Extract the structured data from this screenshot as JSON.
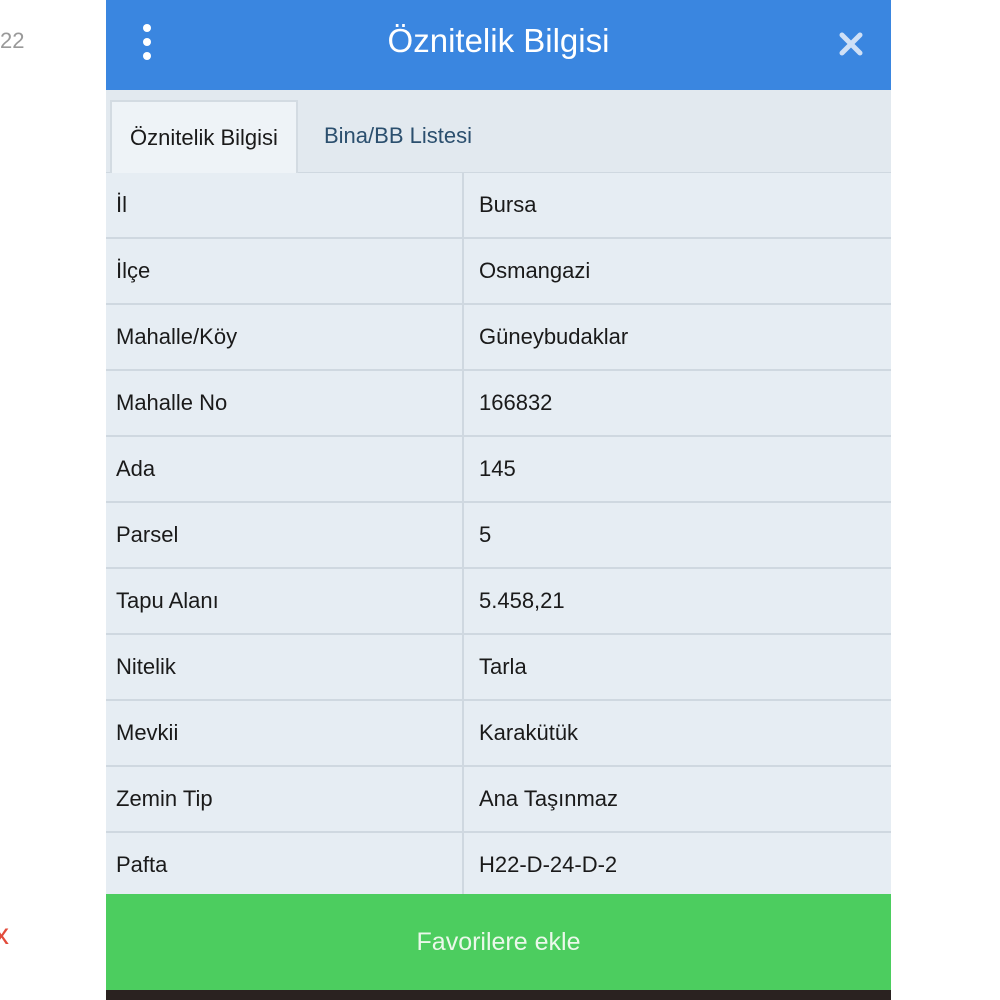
{
  "background": {
    "top_fragment": "22",
    "x_fragment": "x"
  },
  "header": {
    "title": "Öznitelik Bilgisi",
    "menu_icon": "vertical-dots-icon",
    "close_icon": "close-icon",
    "color": "#3a86e0"
  },
  "tabs": [
    {
      "label": "Öznitelik Bilgisi",
      "active": true
    },
    {
      "label": "Bina/BB Listesi",
      "active": false
    }
  ],
  "rows": [
    {
      "key": "İl",
      "value": "Bursa"
    },
    {
      "key": "İlçe",
      "value": "Osmangazi"
    },
    {
      "key": "Mahalle/Köy",
      "value": "Güneybudaklar"
    },
    {
      "key": "Mahalle No",
      "value": "166832"
    },
    {
      "key": "Ada",
      "value": "145"
    },
    {
      "key": "Parsel",
      "value": "5"
    },
    {
      "key": "Tapu Alanı",
      "value": "5.458,21"
    },
    {
      "key": "Nitelik",
      "value": "Tarla"
    },
    {
      "key": "Mevkii",
      "value": "Karakütük"
    },
    {
      "key": "Zemin Tip",
      "value": "Ana Taşınmaz"
    },
    {
      "key": "Pafta",
      "value": "H22-D-24-D-2"
    }
  ],
  "footer": {
    "favorite_button_label": "Favorilere ekle",
    "button_color": "#4ccd5f"
  }
}
